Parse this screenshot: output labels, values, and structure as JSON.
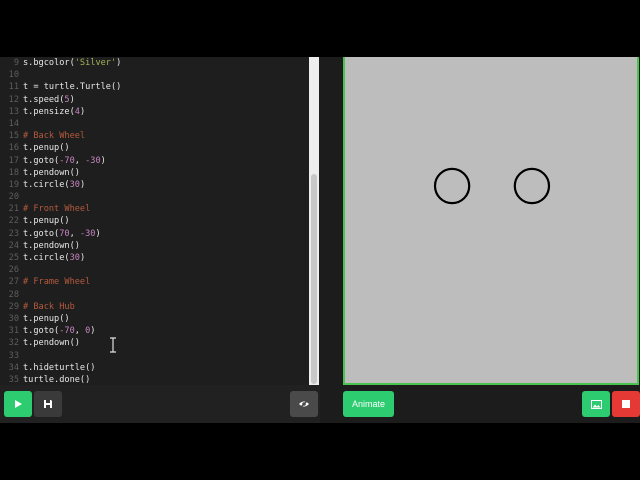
{
  "editor": {
    "lines": [
      {
        "n": "9",
        "text": "s.bgcolor('Silver')",
        "kind": "code"
      },
      {
        "n": "10",
        "text": "",
        "kind": "code"
      },
      {
        "n": "11",
        "text": "t = turtle.Turtle()",
        "kind": "code"
      },
      {
        "n": "12",
        "text": "t.speed(5)",
        "kind": "code"
      },
      {
        "n": "13",
        "text": "t.pensize(4)",
        "kind": "code"
      },
      {
        "n": "14",
        "text": "",
        "kind": "code"
      },
      {
        "n": "15",
        "text": "# Back Wheel",
        "kind": "comment"
      },
      {
        "n": "16",
        "text": "t.penup()",
        "kind": "code"
      },
      {
        "n": "17",
        "text": "t.goto(-70, -30)",
        "kind": "code"
      },
      {
        "n": "18",
        "text": "t.pendown()",
        "kind": "code"
      },
      {
        "n": "19",
        "text": "t.circle(30)",
        "kind": "code"
      },
      {
        "n": "20",
        "text": "",
        "kind": "code"
      },
      {
        "n": "21",
        "text": "# Front Wheel",
        "kind": "comment"
      },
      {
        "n": "22",
        "text": "t.penup()",
        "kind": "code"
      },
      {
        "n": "23",
        "text": "t.goto(70, -30)",
        "kind": "code"
      },
      {
        "n": "24",
        "text": "t.pendown()",
        "kind": "code"
      },
      {
        "n": "25",
        "text": "t.circle(30)",
        "kind": "code"
      },
      {
        "n": "26",
        "text": "",
        "kind": "code"
      },
      {
        "n": "27",
        "text": "# Frame Wheel",
        "kind": "comment"
      },
      {
        "n": "28",
        "text": "",
        "kind": "code"
      },
      {
        "n": "29",
        "text": "# Back Hub",
        "kind": "comment"
      },
      {
        "n": "30",
        "text": "t.penup()",
        "kind": "code"
      },
      {
        "n": "31",
        "text": "t.goto(-70, 0)",
        "kind": "code"
      },
      {
        "n": "32",
        "text": "t.pendown()",
        "kind": "code"
      },
      {
        "n": "33",
        "text": "",
        "kind": "code"
      },
      {
        "n": "34",
        "text": "t.hideturtle()",
        "kind": "code"
      },
      {
        "n": "35",
        "text": "turtle.done()",
        "kind": "code"
      }
    ]
  },
  "toolbar": {
    "run_icon": "play-icon",
    "save_icon": "save-icon",
    "hide_icon": "eye-slash-icon",
    "animate_label": "Animate",
    "screenshot_icon": "image-icon",
    "stop_icon": "stop-icon"
  },
  "canvas": {
    "background": "#bdbdbd",
    "border_color": "#49c44e",
    "pensize": 4,
    "wheels": [
      {
        "name": "back-wheel",
        "x": -70,
        "y": -30,
        "radius": 30
      },
      {
        "name": "front-wheel",
        "x": 70,
        "y": -30,
        "radius": 30
      }
    ]
  },
  "colors": {
    "accent_green": "#2ecc71",
    "stop_red": "#e53935",
    "comment": "#b45a3c"
  }
}
